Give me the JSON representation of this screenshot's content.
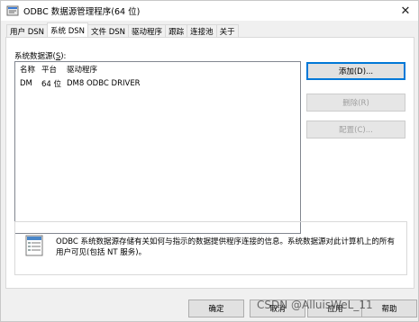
{
  "window": {
    "title": "ODBC 数据源管理程序(64 位)",
    "close_glyph": "✕"
  },
  "tabs": [
    {
      "label": "用户 DSN"
    },
    {
      "label": "系统 DSN"
    },
    {
      "label": "文件 DSN"
    },
    {
      "label": "驱动程序"
    },
    {
      "label": "跟踪"
    },
    {
      "label": "连接池"
    },
    {
      "label": "关于"
    }
  ],
  "active_tab": "系统 DSN",
  "system_dsn": {
    "section_label_prefix": "系统数据源(",
    "section_label_key": "S",
    "section_label_suffix": "):",
    "columns": {
      "name": "名称",
      "platform": "平台",
      "driver": "驱动程序"
    },
    "rows": [
      {
        "name": "DM",
        "platform": "64 位",
        "driver": "DM8 ODBC DRIVER"
      }
    ]
  },
  "buttons": {
    "add": "添加(D)...",
    "remove": "删除(R)",
    "configure": "配置(C)..."
  },
  "info": {
    "text": "ODBC 系统数据源存储有关如何与指示的数据提供程序连接的信息。系统数据源对此计算机上的所有用户可见(包括 NT 服务)。"
  },
  "footer": {
    "ok": "确定",
    "cancel": "取消",
    "apply": "应用",
    "help": "帮助",
    "watermark": "CSDN @AlluisWeL_11"
  },
  "colors": {
    "accent": "#0078d7",
    "panel_bg": "#ffffff",
    "window_bg": "#f0f0f0"
  }
}
